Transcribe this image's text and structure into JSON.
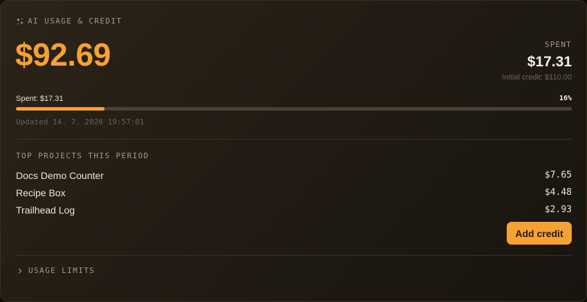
{
  "header": {
    "title": "AI USAGE & CREDIT",
    "icon": "sparkles-icon"
  },
  "balance": {
    "amount": "$92.69"
  },
  "spent": {
    "caption": "SPENT",
    "amount": "$17.31",
    "initial_credit": "Initial credit: $110.00"
  },
  "progress": {
    "label": "Spent: $17.31",
    "percent_text": "16%",
    "fraction": 0.16
  },
  "updated": "Updated 14. 7. 2026 19:57:01",
  "top_projects": {
    "title": "TOP PROJECTS THIS PERIOD",
    "items": [
      {
        "name": "Docs Demo Counter",
        "cost": "$7.65"
      },
      {
        "name": "Recipe Box",
        "cost": "$4.48"
      },
      {
        "name": "Trailhead Log",
        "cost": "$2.93"
      }
    ]
  },
  "actions": {
    "add_credit_label": "Add credit"
  },
  "usage_limits": {
    "label": "USAGE LIMITS",
    "icon": "chevron-right-icon"
  },
  "colors": {
    "accent": "#f5a136",
    "track": "#4a4134"
  }
}
